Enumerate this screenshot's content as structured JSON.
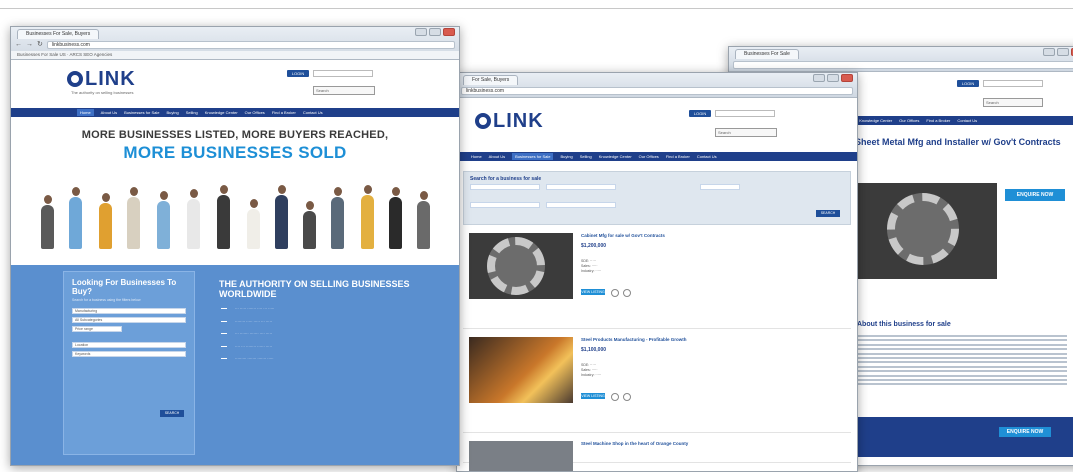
{
  "window1": {
    "tab_label": "Businesses For Sale, Buyers",
    "url": "linkbusiness.com",
    "bookmarks": "Businesses For Sale US · ARCS SEO Agencies",
    "logo_text": "LINK",
    "tagline": "The authority on selling businesses",
    "login_label": "LOGIN",
    "search_placeholder": "Search",
    "nav": [
      "Home",
      "About Us",
      "Businesses for Sale",
      "Buying",
      "Selling",
      "Knowledge Center",
      "Our Offices",
      "Find a Broker",
      "Contact Us"
    ],
    "hero_line1": "MORE BUSINESSES LISTED, MORE BUYERS REACHED,",
    "hero_line2": "MORE BUSINESSES SOLD",
    "look_title": "Looking For Businesses To Buy?",
    "look_sub": "Search for a business using the filters below",
    "look_fields": [
      "Manufacturing",
      "All Subcategories",
      "Price range",
      "Location",
      "Keywords"
    ],
    "search_button": "SEARCH",
    "authority_title": "THE AUTHORITY ON SELLING BUSINESSES WORLDWIDE"
  },
  "window2": {
    "tab_label": "For Sale, Buyers",
    "url": "linkbusiness.com",
    "logo_text": "LINK",
    "login_label": "LOGIN",
    "search_placeholder": "Search",
    "results_title": "Search for a business for sale",
    "listings": [
      {
        "title": "Cabinet Mfg for sale w/ Gov't Contracts",
        "price": "$1,200,000"
      },
      {
        "title": "Steel Products Manufacturing - Profitable Growth",
        "price": "$1,100,000"
      },
      {
        "title": "Steel Machine Shop in the heart of Orange County",
        "price": ""
      }
    ],
    "more_info": "VIEW LISTING"
  },
  "window3": {
    "tab_label": "Businesses For Sale",
    "login_label": "LOGIN",
    "search_placeholder": "Search",
    "detail_title": "Sheet Metal Mfg and Installer w/ Gov't Contracts",
    "enquire_label": "ENQUIRE NOW",
    "about_heading": "About this business for sale",
    "enquire_footer": "ENQUIRE NOW"
  }
}
